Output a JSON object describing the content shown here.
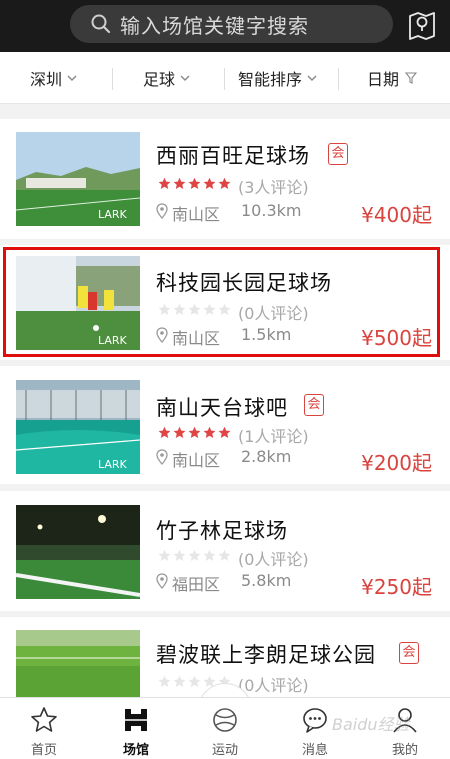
{
  "search": {
    "placeholder": "输入场馆关键字搜索",
    "icon": "search-icon",
    "map_icon": "map-pin-icon"
  },
  "filters": [
    {
      "label": "深圳",
      "icon": "chevron-down-icon"
    },
    {
      "label": "足球",
      "icon": "chevron-down-icon"
    },
    {
      "label": "智能排序",
      "icon": "chevron-down-icon"
    },
    {
      "label": "日期",
      "icon": "filter-icon"
    }
  ],
  "venues": [
    {
      "name": "西丽百旺足球场",
      "member_badge": "会",
      "rating": 5,
      "reviews": "(3人评论)",
      "district": "南山区",
      "distance": "10.3km",
      "price": "¥400起"
    },
    {
      "name": "科技园长园足球场",
      "member_badge": "",
      "rating": 0,
      "reviews": "(0人评论)",
      "district": "南山区",
      "distance": "1.5km",
      "price": "¥500起",
      "highlighted": true
    },
    {
      "name": "南山天台球吧",
      "member_badge": "会",
      "rating": 5,
      "reviews": "(1人评论)",
      "district": "南山区",
      "distance": "2.8km",
      "price": "¥200起"
    },
    {
      "name": "竹子林足球场",
      "member_badge": "",
      "rating": 0,
      "reviews": "(0人评论)",
      "district": "福田区",
      "distance": "5.8km",
      "price": "¥250起"
    },
    {
      "name": "碧波联上李朗足球公园",
      "member_badge": "会",
      "rating": 0,
      "reviews": "(0人评论)",
      "district": "",
      "distance": "",
      "price": ""
    }
  ],
  "tabbar": [
    {
      "label": "首页",
      "icon": "star-icon"
    },
    {
      "label": "场馆",
      "icon": "field-icon",
      "active": true
    },
    {
      "label": "运动",
      "icon": "ball-icon"
    },
    {
      "label": "消息",
      "icon": "chat-icon"
    },
    {
      "label": "我的",
      "icon": "user-icon"
    }
  ],
  "watermark": "Baidu经验",
  "colors": {
    "accent": "#d9443f",
    "star_active": "#e04545",
    "star_inactive": "#e6e6e6",
    "highlight": "#e00d0d",
    "topbar": "#1a1a1a"
  }
}
